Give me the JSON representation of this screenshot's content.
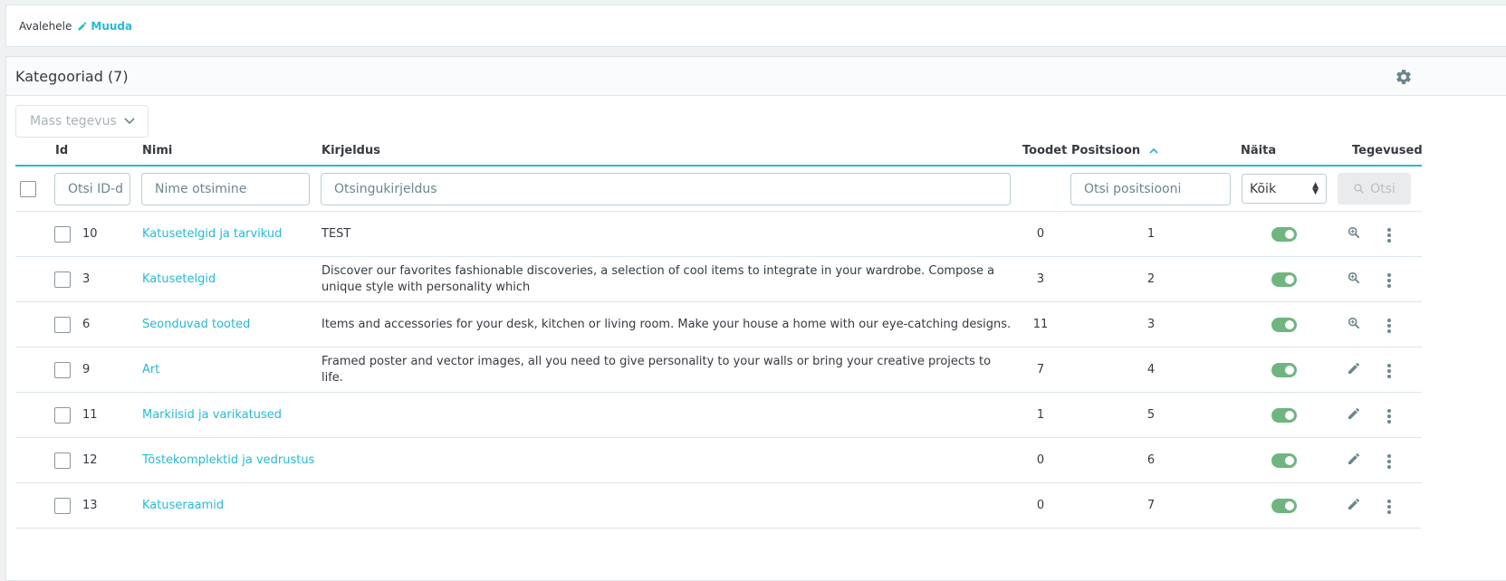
{
  "breadcrumb": {
    "home": "Avalehele",
    "edit": "Muuda"
  },
  "panel": {
    "title": "Kategooriad (7)"
  },
  "bulk": {
    "label": "Mass tegevus"
  },
  "columns": {
    "id": "Id",
    "name": "Nimi",
    "description": "Kirjeldus",
    "products": "Toodet",
    "position": "Positsioon",
    "active": "Näita",
    "actions": "Tegevused"
  },
  "filters": {
    "id_placeholder": "Otsi ID-d",
    "name_placeholder": "Nime otsimine",
    "description_placeholder": "Otsingukirjeldus",
    "position_placeholder": "Otsi positsiooni",
    "active_value": "Kõik",
    "search_label": "Otsi"
  },
  "rows": [
    {
      "id": "10",
      "name": "Katusetelgid ja tarvikud",
      "description": "TEST",
      "products": "0",
      "position": "1",
      "active": true,
      "action_icon": "zoom-icon"
    },
    {
      "id": "3",
      "name": "Katusetelgid",
      "description": "Discover our favorites fashionable discoveries, a selection of cool items to integrate in your wardrobe. Compose a unique style with personality which",
      "products": "3",
      "position": "2",
      "active": true,
      "action_icon": "zoom-icon"
    },
    {
      "id": "6",
      "name": "Seonduvad tooted",
      "description": "Items and accessories for your desk, kitchen or living room. Make your house a home with our eye-catching designs.",
      "products": "11",
      "position": "3",
      "active": true,
      "action_icon": "zoom-icon"
    },
    {
      "id": "9",
      "name": "Art",
      "description": "Framed poster and vector images, all you need to give personality to your walls or bring your creative projects to life.",
      "products": "7",
      "position": "4",
      "active": true,
      "action_icon": "pencil-icon"
    },
    {
      "id": "11",
      "name": "Markiisid ja varikatused",
      "description": "",
      "products": "1",
      "position": "5",
      "active": true,
      "action_icon": "pencil-icon"
    },
    {
      "id": "12",
      "name": "Tõstekomplektid ja vedrustus",
      "description": "",
      "products": "0",
      "position": "6",
      "active": true,
      "action_icon": "pencil-icon"
    },
    {
      "id": "13",
      "name": "Katuseraamid",
      "description": "",
      "products": "0",
      "position": "7",
      "active": true,
      "action_icon": "pencil-icon"
    }
  ],
  "colors": {
    "accent": "#25b9d7",
    "toggle_on": "#70b580",
    "text": "#363a41"
  }
}
